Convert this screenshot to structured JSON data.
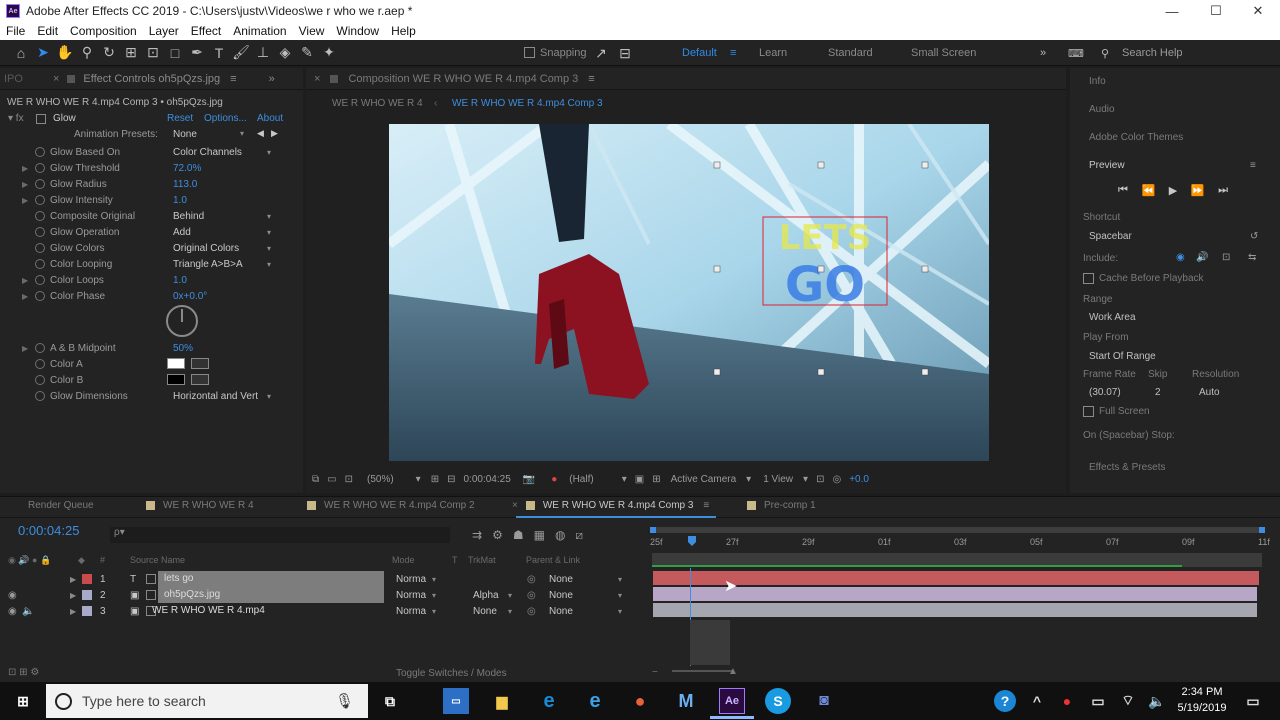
{
  "window": {
    "title": "Adobe After Effects CC 2019 - C:\\Users\\justv\\Videos\\we r who we r.aep *",
    "logo_text": "Ae",
    "controls": {
      "minimize": "—",
      "maximize": "☐",
      "close": "✕"
    }
  },
  "menu": [
    "File",
    "Edit",
    "Composition",
    "Layer",
    "Effect",
    "Animation",
    "View",
    "Window",
    "Help"
  ],
  "toolbar": {
    "snapping_label": "Snapping",
    "workspaces": [
      "Default",
      "Learn",
      "Standard",
      "Small Screen"
    ],
    "active_workspace": "Default",
    "search_help": "Search Help"
  },
  "effect_panel": {
    "tab_label": "Effect Controls oh5pQzs.jpg",
    "layer_path": "WE R WHO WE R 4.mp4 Comp 3 • oh5pQzs.jpg",
    "effect_name": "Glow",
    "reset": "Reset",
    "options": "Options...",
    "about": "About",
    "presets_label": "Animation Presets:",
    "presets_value": "None",
    "props": [
      {
        "name": "Glow Based On",
        "value": "Color Channels",
        "type": "dd"
      },
      {
        "name": "Glow Threshold",
        "value": "72.0%",
        "type": "num"
      },
      {
        "name": "Glow Radius",
        "value": "113.0",
        "type": "num"
      },
      {
        "name": "Glow Intensity",
        "value": "1.0",
        "type": "num"
      },
      {
        "name": "Composite Original",
        "value": "Behind",
        "type": "dd"
      },
      {
        "name": "Glow Operation",
        "value": "Add",
        "type": "dd"
      },
      {
        "name": "Glow Colors",
        "value": "Original Colors",
        "type": "dd"
      },
      {
        "name": "Color Looping",
        "value": "Triangle A>B>A",
        "type": "dd"
      },
      {
        "name": "Color Loops",
        "value": "1.0",
        "type": "num"
      },
      {
        "name": "Color Phase",
        "value": "0x+0.0°",
        "type": "num"
      }
    ],
    "props2": [
      {
        "name": "A & B Midpoint",
        "value": "50%",
        "type": "num"
      },
      {
        "name": "Color A",
        "value": "",
        "type": "swatch",
        "color": "#ffffff"
      },
      {
        "name": "Color B",
        "value": "",
        "type": "swatch",
        "color": "#000000"
      },
      {
        "name": "Glow Dimensions",
        "value": "Horizontal and Vert",
        "type": "dd"
      }
    ]
  },
  "composition": {
    "tab_label": "Composition WE R WHO WE R 4.mp4 Comp 3",
    "breadcrumbs": [
      "WE R WHO WE R 4",
      "WE R WHO WE R 4.mp4 Comp 3"
    ],
    "overlay_text_top": "LETS",
    "overlay_text_bottom": "GO",
    "zoom": "(50%)",
    "timecode": "0:00:04:25",
    "resolution": "(Half)",
    "camera": "Active Camera",
    "views": "1 View",
    "exposure": "+0.0"
  },
  "right_panel": {
    "info": "Info",
    "audio": "Audio",
    "color_themes": "Adobe Color Themes",
    "preview": "Preview",
    "shortcut_label": "Shortcut",
    "shortcut_value": "Spacebar",
    "include_label": "Include:",
    "cache_label": "Cache Before Playback",
    "range_label": "Range",
    "range_value": "Work Area",
    "play_from_label": "Play From",
    "play_from_value": "Start Of Range",
    "frame_rate_label": "Frame Rate",
    "skip_label": "Skip",
    "resolution_label": "Resolution",
    "frame_rate_value": "(30.07)",
    "skip_value": "2",
    "resolution_value": "Auto",
    "full_screen": "Full Screen",
    "spacebar_stop": "On (Spacebar) Stop:",
    "effects_presets": "Effects & Presets"
  },
  "timeline": {
    "tabs": [
      {
        "label": "Render Queue",
        "color": ""
      },
      {
        "label": "WE R WHO WE R 4",
        "color": "#c8b98a"
      },
      {
        "label": "WE R WHO WE R 4.mp4 Comp 2",
        "color": "#c8b98a"
      },
      {
        "label": "WE R WHO WE R 4.mp4 Comp 3",
        "color": "#c8b98a"
      },
      {
        "label": "Pre-comp 1",
        "color": "#c8b98a"
      }
    ],
    "active_tab": "WE R WHO WE R 4.mp4 Comp 3",
    "current_time": "0:00:04:25",
    "search_placeholder": "ρ▾",
    "col_source": "Source Name",
    "col_mode": "Mode",
    "col_t": "T",
    "col_trkmat": "TrkMat",
    "col_parent": "Parent & Link",
    "ruler": [
      "25f",
      "27f",
      "29f",
      "01f",
      "03f",
      "05f",
      "07f",
      "09f",
      "11f"
    ],
    "layers": [
      {
        "num": "1",
        "type": "T",
        "name": "lets  go",
        "mode": "Norma",
        "trkmat": "",
        "parent": "None",
        "color": "#c94c4c"
      },
      {
        "num": "2",
        "type": "▣",
        "name": "oh5pQzs.jpg",
        "mode": "Norma",
        "trkmat": "Alpha",
        "parent": "None",
        "color": "#a9a9c9"
      },
      {
        "num": "3",
        "type": "▣",
        "name": "WE R WHO WE R 4.mp4",
        "mode": "Norma",
        "trkmat": "None",
        "parent": "None",
        "color": "#a9a9c9"
      }
    ],
    "toggle_label": "Toggle Switches / Modes"
  },
  "taskbar": {
    "search_placeholder": "Type here to search",
    "time": "2:34 PM",
    "date": "5/19/2019",
    "apps": [
      "file-explorer",
      "store",
      "edge",
      "internet-explorer",
      "firefox",
      "visual-studio",
      "after-effects",
      "skype",
      "discord"
    ]
  }
}
